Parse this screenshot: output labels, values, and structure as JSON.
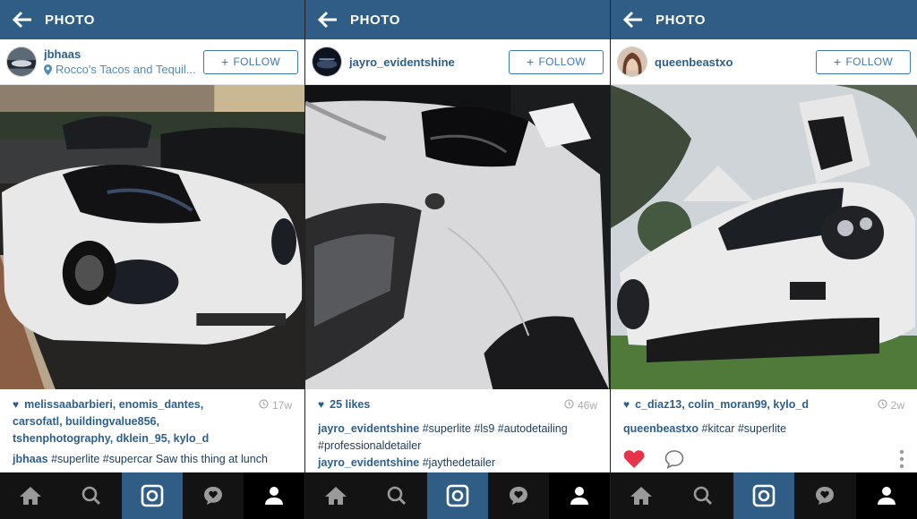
{
  "topbar": {
    "title": "PHOTO"
  },
  "posts": [
    {
      "username": "jbhaas",
      "location": "Rocco's Tacos and Tequil...",
      "follow_label": "FOLLOW",
      "likes_line1": "melissaabarbieri, enomis_dantes,",
      "likes_line2": "carsofatl, buildingvalue856,",
      "likes_line3": "tshenphotography, dklein_95, kylo_d",
      "time": "17w",
      "caption_user": "jbhaas",
      "caption_text": "#superlite #supercar Saw this thing at lunch"
    },
    {
      "username": "jayro_evidentshine",
      "follow_label": "FOLLOW",
      "likes": "25 likes",
      "time": "46w",
      "caption1_user": "jayro_evidentshine",
      "caption1_text": "#superlite #ls9 #autodetailing",
      "caption1_line2": "#professionaldetailer",
      "caption2_user": "jayro_evidentshine",
      "caption2_text": "#jaythedetailer"
    },
    {
      "username": "queenbeastxo",
      "follow_label": "FOLLOW",
      "likes": "c_diaz13, colin_moran99, kylo_d",
      "time": "2w",
      "caption_user": "queenbeastxo",
      "caption_text": "#kitcar #superlite"
    }
  ],
  "colors": {
    "topbar": "#2f5d86",
    "link": "#2d5f8b",
    "like_red": "#e8344b",
    "tabbar": "#131313"
  },
  "tabs": [
    "home-icon",
    "search-icon",
    "camera-icon",
    "activity-icon",
    "profile-icon"
  ]
}
